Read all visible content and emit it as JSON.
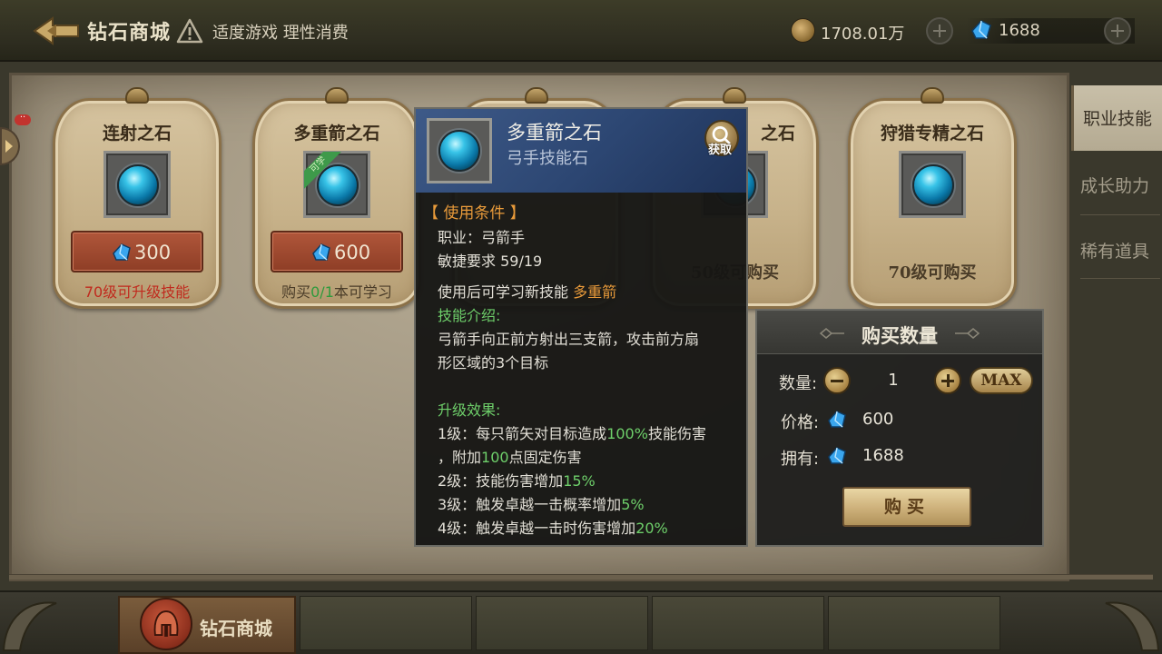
{
  "header": {
    "title": "钻石商城",
    "notice": "适度游戏 理性消费",
    "gold": "1708.01万",
    "diamonds": "1688"
  },
  "side_tabs": [
    {
      "label": "职业技能",
      "active": true
    },
    {
      "label": "成长助力",
      "active": false
    },
    {
      "label": "稀有道具",
      "active": false
    }
  ],
  "cards": [
    {
      "name": "连射之石",
      "price": "300",
      "note": "70级可升级技能"
    },
    {
      "name": "多重箭之石",
      "badge": "可学",
      "price": "600",
      "note_prefix": "购买",
      "note_count": "0/1",
      "note_suffix": "本可学习"
    },
    {
      "name": "",
      "note": ""
    },
    {
      "name": "之石",
      "note": "50级可购买"
    },
    {
      "name": "狩猎专精之石",
      "note": "70级可购买"
    }
  ],
  "tooltip": {
    "name": "多重箭之石",
    "type": "弓手技能石",
    "get_label": "获取",
    "condition_header": "【 使用条件 】",
    "job": "职业：弓箭手",
    "agility": "敏捷要求 59/19",
    "learn_prefix": "使用后可学习新技能",
    "learn_skill": "多重箭",
    "intro_header": "技能介绍:",
    "intro_1": "弓箭手向正前方射出三支箭，攻击前方扇",
    "intro_2": "形区域的3个目标",
    "upgrade_header": "升级效果:",
    "lv1_a": "1级：每只箭矢对目标造成",
    "lv1_b": "100%",
    "lv1_c": "技能伤害",
    "lv1_d": "，附加",
    "lv1_e": "100",
    "lv1_f": "点固定伤害",
    "lv2_a": "2级：技能伤害增加",
    "lv2_b": "15%",
    "lv3_a": "3级：触发卓越一击概率增加",
    "lv3_b": "5%",
    "lv4_a": "4级：触发卓越一击时伤害增加",
    "lv4_b": "20%"
  },
  "buy_panel": {
    "title": "购买数量",
    "qty_label": "数量:",
    "qty": "1",
    "max_label": "MAX",
    "price_label": "价格:",
    "price": "600",
    "own_label": "拥有:",
    "own": "1688",
    "buy_label": "购买"
  },
  "bottom": {
    "active_label": "钻石商城"
  },
  "colors": {
    "accent_orange": "#e89a3a",
    "accent_green": "#6ecf6a",
    "price_red": "#c02a1e"
  }
}
